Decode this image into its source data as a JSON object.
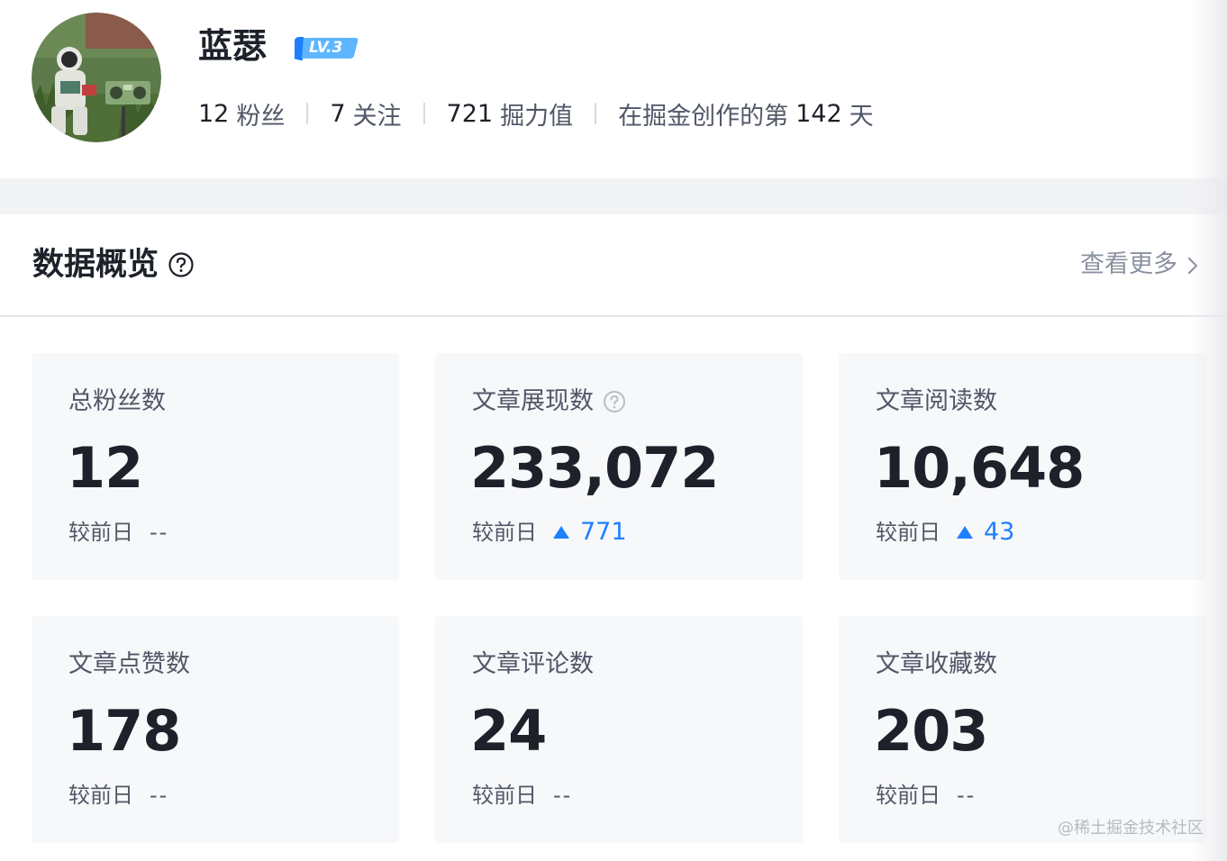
{
  "profile": {
    "username": "蓝瑟",
    "level": "LV.3",
    "followers_count": "12",
    "followers_label": "粉丝",
    "following_count": "7",
    "following_label": "关注",
    "power_count": "721",
    "power_label": "掘力值",
    "days_prefix": "在掘金创作的第",
    "days_count": "142",
    "days_suffix": "天"
  },
  "overview": {
    "title": "数据概览",
    "more_label": "查看更多"
  },
  "cards": [
    {
      "label": "总粉丝数",
      "value": "12",
      "compare_label": "较前日",
      "delta": "--",
      "trend": "none",
      "help": false
    },
    {
      "label": "文章展现数",
      "value": "233,072",
      "compare_label": "较前日",
      "delta": "771",
      "trend": "up",
      "help": true
    },
    {
      "label": "文章阅读数",
      "value": "10,648",
      "compare_label": "较前日",
      "delta": "43",
      "trend": "up",
      "help": false
    },
    {
      "label": "文章点赞数",
      "value": "178",
      "compare_label": "较前日",
      "delta": "--",
      "trend": "none",
      "help": false
    },
    {
      "label": "文章评论数",
      "value": "24",
      "compare_label": "较前日",
      "delta": "--",
      "trend": "none",
      "help": false
    },
    {
      "label": "文章收藏数",
      "value": "203",
      "compare_label": "较前日",
      "delta": "--",
      "trend": "none",
      "help": false
    }
  ],
  "watermark": "@稀土掘金技术社区",
  "colors": {
    "accent": "#1e80ff",
    "card_bg": "#f7f8fa",
    "text_primary": "#1d2129",
    "text_secondary": "#515767"
  }
}
